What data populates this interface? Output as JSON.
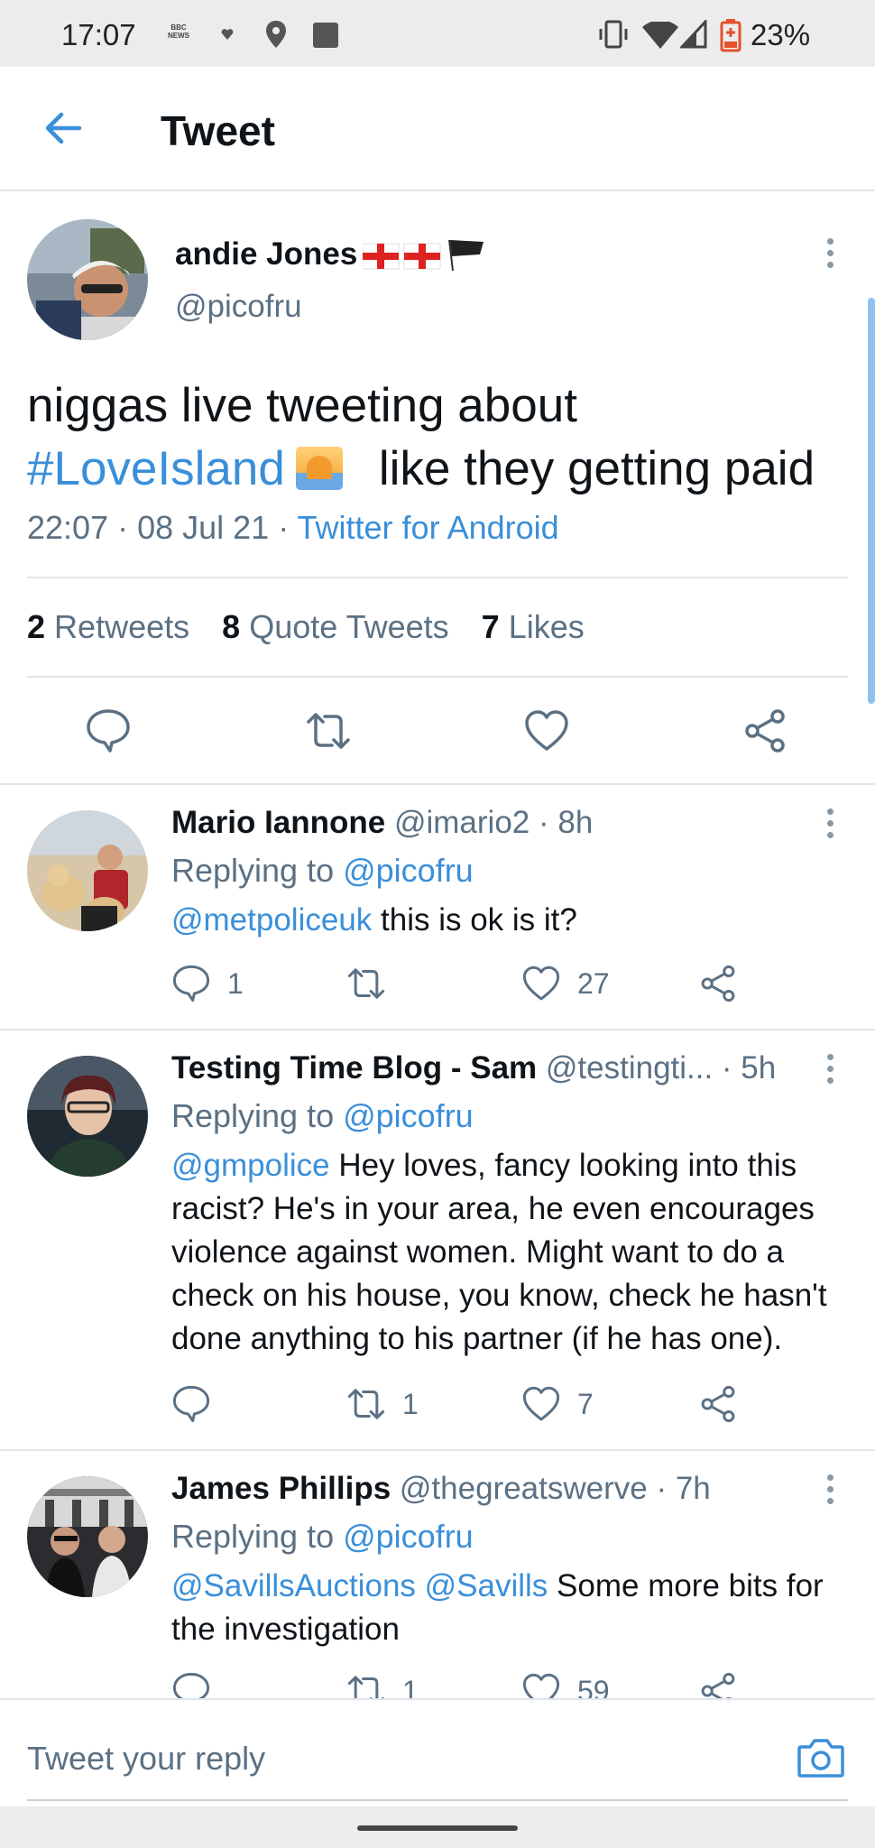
{
  "status_bar": {
    "time": "17:07",
    "news_icon_text": "BBC NEWS",
    "battery_percent": "23%"
  },
  "header": {
    "title": "Tweet"
  },
  "tweet": {
    "author_name": "andie Jones",
    "author_handle": "@picofru",
    "text_line1": "niggas live tweeting about",
    "hashtag": "#LoveIsland",
    "text_line2_rest": "like they getting paid",
    "timestamp": "22:07 · 08 Jul 21 · ",
    "source": "Twitter for Android",
    "stats": {
      "retweets_count": "2",
      "retweets_label": "Retweets",
      "quotes_count": "8",
      "quotes_label": "Quote Tweets",
      "likes_count": "7",
      "likes_label": "Likes"
    }
  },
  "replies": [
    {
      "name": "Mario Iannone",
      "handle_time": " @imario2 · 8h",
      "replying_prefix": "Replying to ",
      "replying_to": "@picofru",
      "mention": "@metpoliceuk",
      "text": " this is ok is it?",
      "reply_count": "1",
      "retweet_count": "",
      "like_count": "27"
    },
    {
      "name": "Testing Time Blog - Sam",
      "handle_time": " @testingti...  · 5h",
      "replying_prefix": "Replying to ",
      "replying_to": "@picofru",
      "mention": "@gmpolice",
      "text": " Hey loves, fancy looking into this racist? He's in your area, he even encourages violence against women. Might want to do a check on his house, you know, check he hasn't done anything to his partner (if he has one).",
      "reply_count": "",
      "retweet_count": "1",
      "like_count": "7"
    },
    {
      "name": "James Phillips",
      "handle_time": " @thegreatswerve · 7h",
      "replying_prefix": "Replying to ",
      "replying_to": "@picofru",
      "mention": "@SavillsAuctions @Savills",
      "text": " Some more bits for the investigation",
      "reply_count": "",
      "retweet_count": "1",
      "like_count": "59"
    }
  ],
  "reply_bar": {
    "placeholder": "Tweet your reply"
  },
  "colors": {
    "accent": "#3a8fd9",
    "secondary_text": "#5b7083",
    "divider": "#e1e6ea"
  },
  "icons": {
    "back": "arrow-left-icon",
    "reply": "speech-bubble-icon",
    "retweet": "retweet-icon",
    "like": "heart-icon",
    "share": "share-icon",
    "more": "more-vertical-icon",
    "camera": "camera-icon"
  }
}
